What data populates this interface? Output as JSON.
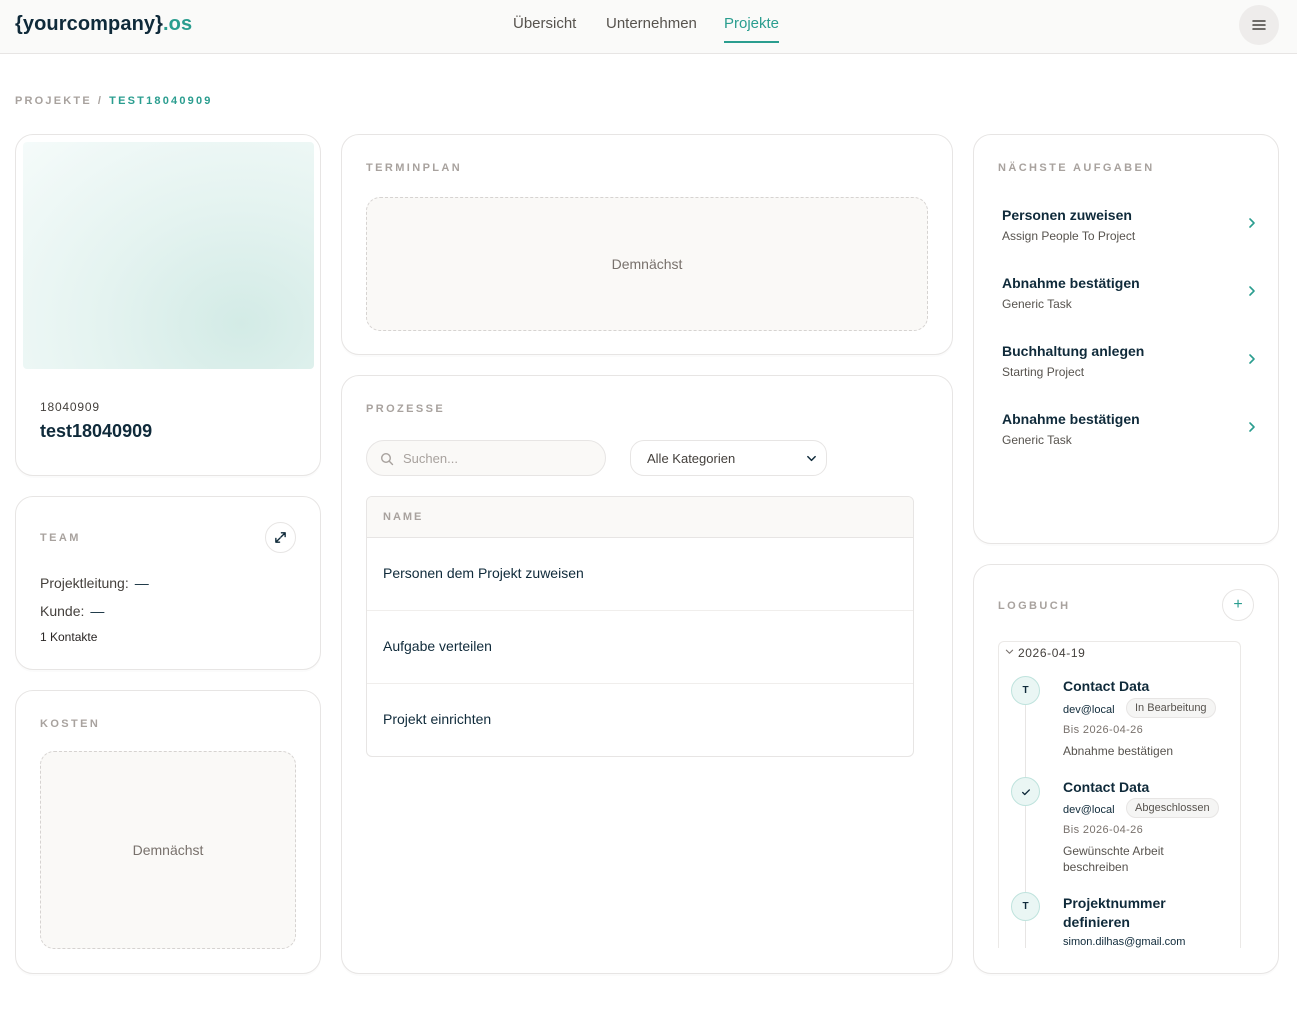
{
  "header": {
    "logo_main": "{yourcompany}",
    "logo_suffix": ".os",
    "nav": [
      {
        "label": "Übersicht"
      },
      {
        "label": "Unternehmen"
      },
      {
        "label": "Projekte"
      }
    ],
    "active_tab": "Projekte",
    "menu_icon": "hamburger-icon"
  },
  "breadcrumb": {
    "root": "PROJEKTE",
    "separator": "/",
    "current": "TEST18040909"
  },
  "project": {
    "number": "18040909",
    "name": "test18040909"
  },
  "team": {
    "label": "TEAM",
    "lead_label": "Projektleitung:",
    "lead_value": "—",
    "customer_label": "Kunde:",
    "customer_value": "—",
    "contacts": "1 Kontakte",
    "expand_icon": "expand-icon"
  },
  "costs": {
    "label": "KOSTEN",
    "placeholder": "Demnächst"
  },
  "schedule": {
    "label": "TERMINPLAN",
    "placeholder": "Demnächst"
  },
  "processes": {
    "label": "PROZESSE",
    "search_placeholder": "Suchen...",
    "category_selected": "Alle Kategorien",
    "column_name": "NAME",
    "rows": [
      {
        "name": "Personen dem Projekt zuweisen"
      },
      {
        "name": "Aufgabe verteilen"
      },
      {
        "name": "Projekt einrichten"
      }
    ]
  },
  "next_tasks": {
    "label": "NÄCHSTE AUFGABEN",
    "items": [
      {
        "title": "Personen zuweisen",
        "subtitle": "Assign People To Project"
      },
      {
        "title": "Abnahme bestätigen",
        "subtitle": "Generic Task"
      },
      {
        "title": "Buchhaltung anlegen",
        "subtitle": "Starting Project"
      },
      {
        "title": "Abnahme bestätigen",
        "subtitle": "Generic Task"
      }
    ]
  },
  "logbook": {
    "label": "LOGBUCH",
    "add_label": "+",
    "date": "2026-04-19",
    "entries": [
      {
        "avatar": "T",
        "title": "Contact Data",
        "user": "dev@local",
        "status": "In Bearbeitung",
        "due": "Bis 2026-04-26",
        "task": "Abnahme bestätigen"
      },
      {
        "avatar": "✓",
        "title": "Contact Data",
        "user": "dev@local",
        "status": "Abgeschlossen",
        "due": "Bis 2026-04-26",
        "task": "Gewünschte Arbeit beschreiben"
      },
      {
        "avatar": "T",
        "title": "Projektnummer definieren",
        "user": "simon.dilhas@gmail.com"
      }
    ]
  },
  "colors": {
    "accent": "#2a9d8f",
    "text": "#0f2a3a",
    "muted": "#a8a29e"
  }
}
